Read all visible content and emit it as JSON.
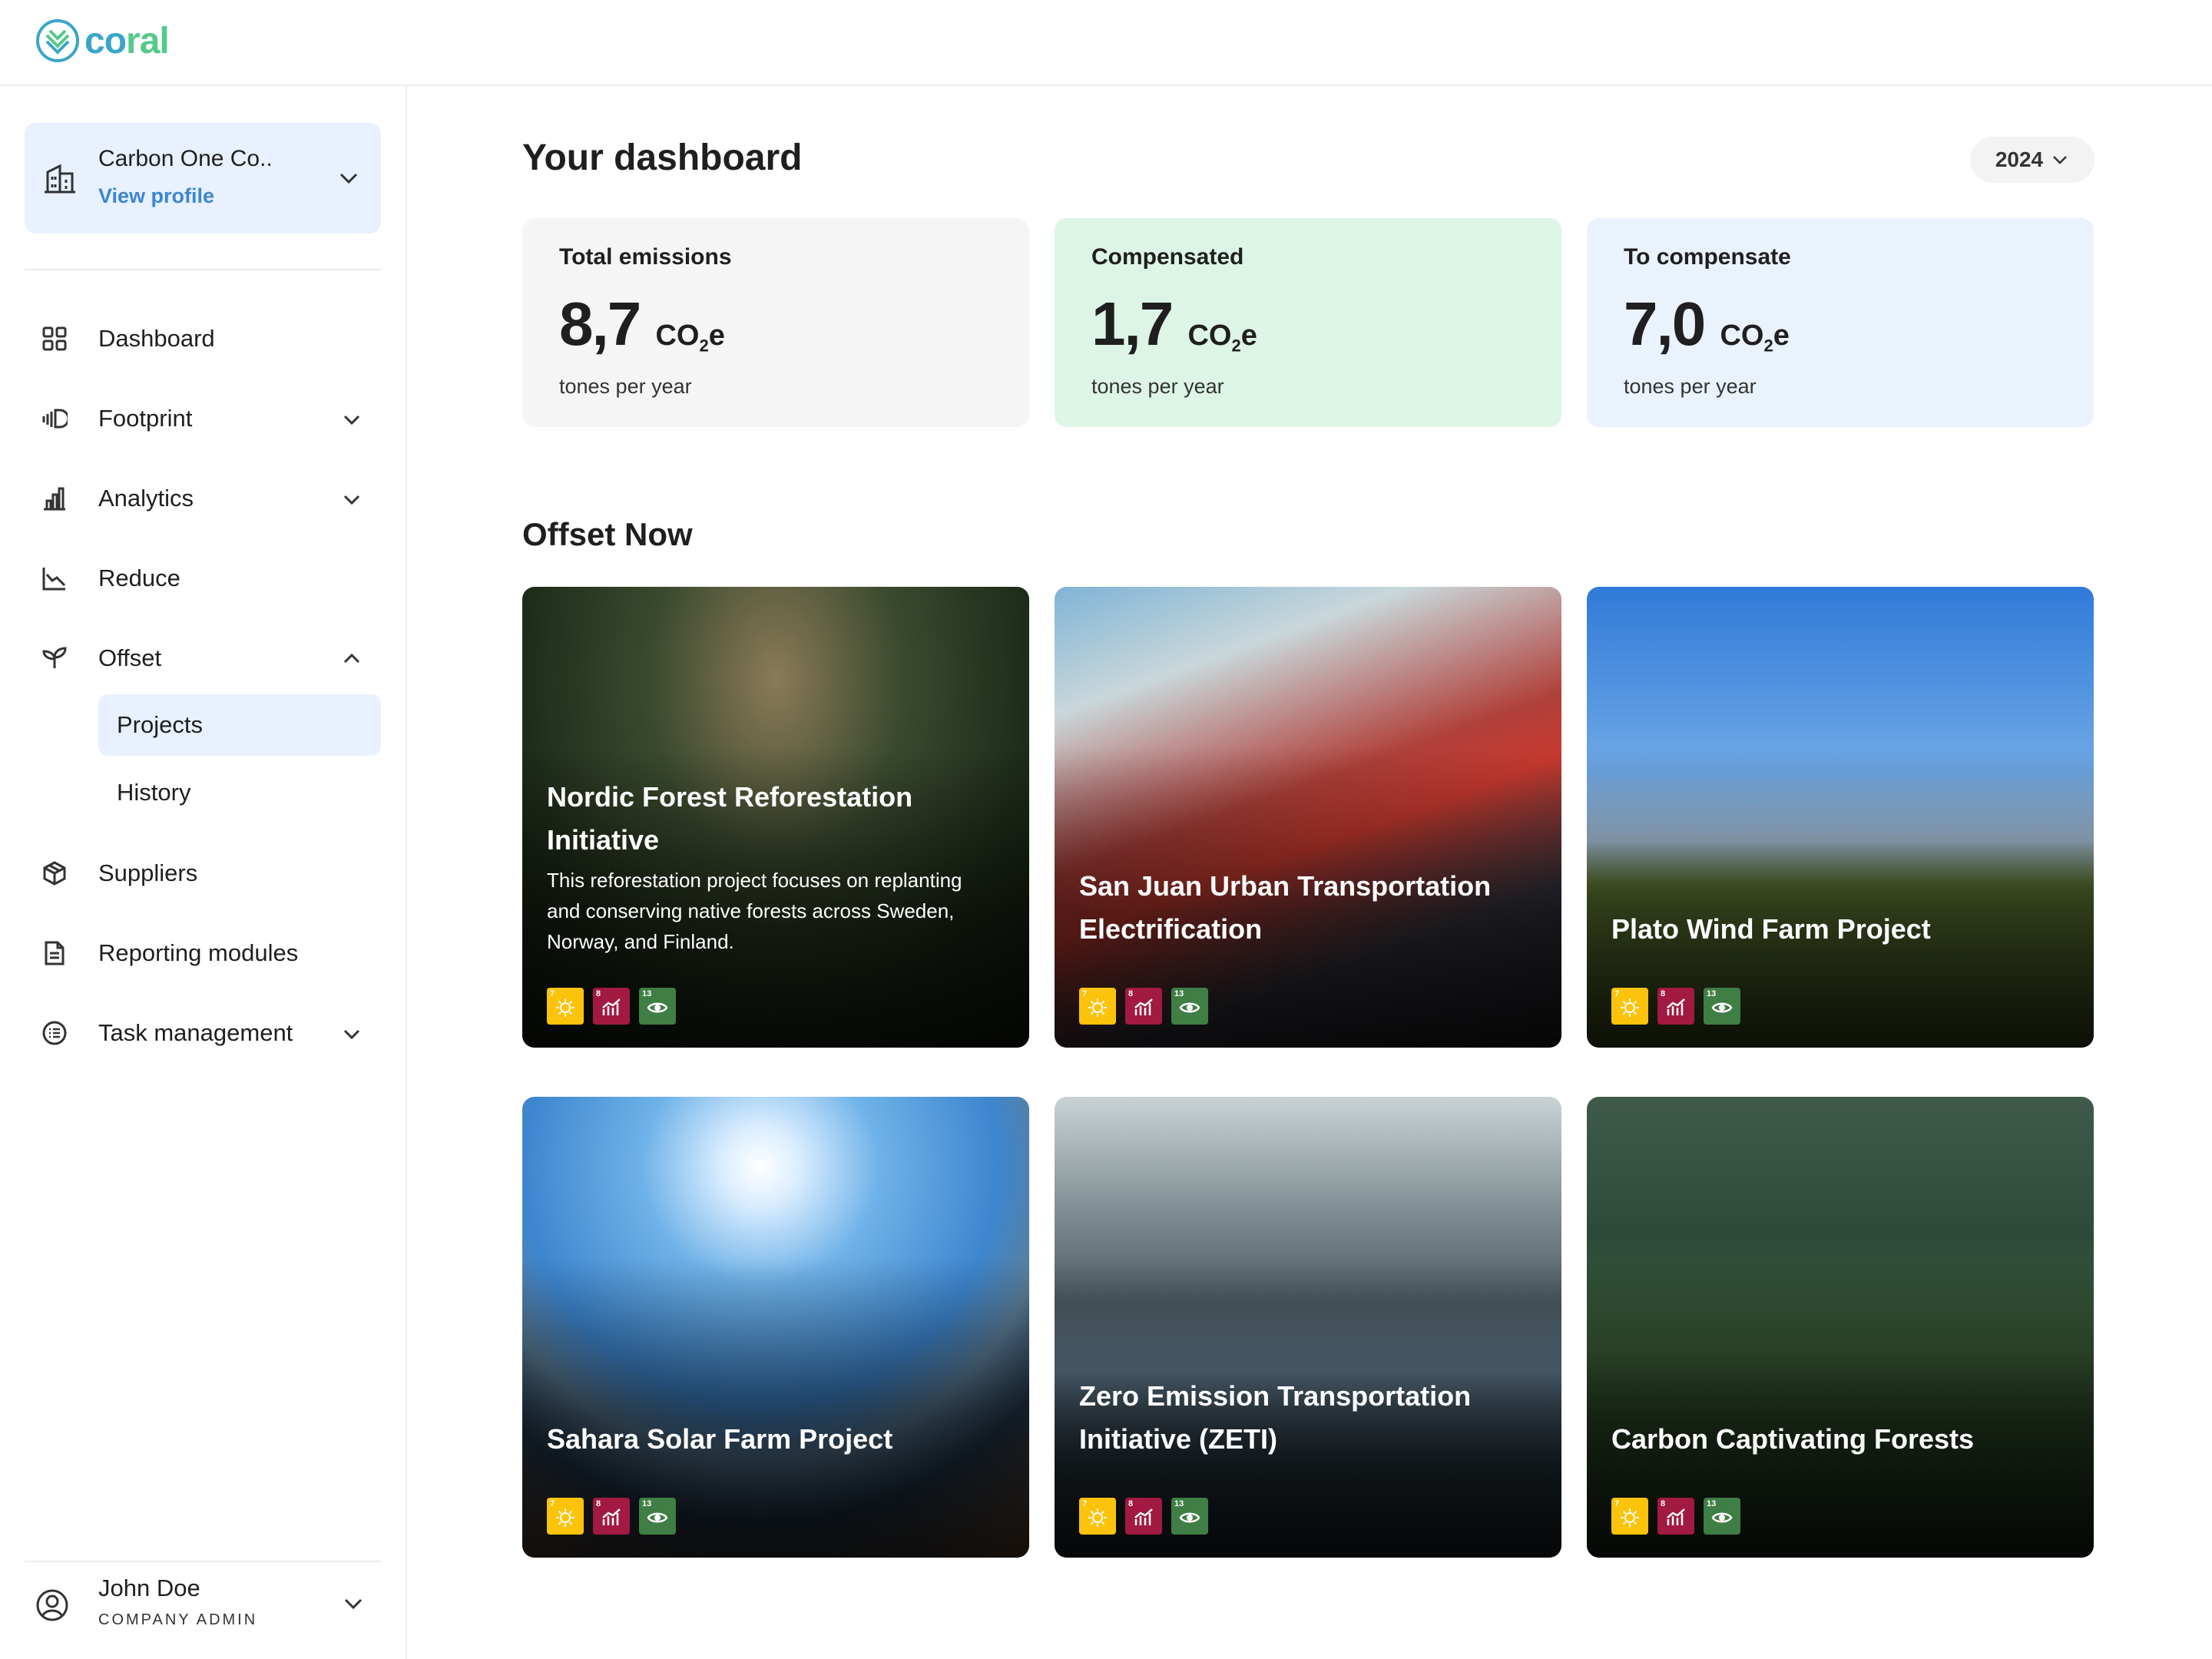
{
  "brand": {
    "name_part1": "co",
    "name_part2": "ral"
  },
  "org": {
    "name": "Carbon One Co..",
    "link": "View profile"
  },
  "nav": {
    "dashboard": "Dashboard",
    "footprint": "Footprint",
    "analytics": "Analytics",
    "reduce": "Reduce",
    "offset": "Offset",
    "projects": "Projects",
    "history": "History",
    "suppliers": "Suppliers",
    "reporting": "Reporting modules",
    "tasks": "Task management"
  },
  "user": {
    "name": "John Doe",
    "role": "COMPANY ADMIN"
  },
  "header": {
    "title": "Your dashboard",
    "year": "2024"
  },
  "stats": [
    {
      "label": "Total emissions",
      "value": "8,7",
      "unit": "CO",
      "unit_sub": "2",
      "unit_tail": "e",
      "caption": "tones per year",
      "bg": "#f5f5f5"
    },
    {
      "label": "Compensated",
      "value": "1,7",
      "unit": "CO",
      "unit_sub": "2",
      "unit_tail": "e",
      "caption": "tones per year",
      "bg": "#dcf5e6"
    },
    {
      "label": "To compensate",
      "value": "7,0",
      "unit": "CO",
      "unit_sub": "2",
      "unit_tail": "e",
      "caption": "tones per year",
      "bg": "#eaf2fd"
    }
  ],
  "offset": {
    "title": "Offset Now",
    "projects": [
      {
        "title": "Nordic Forest Reforestation Initiative",
        "desc": "This reforestation project focuses on replanting and conserving native forests across Sweden, Norway, and Finland."
      },
      {
        "title": "San Juan Urban Transportation Electrification",
        "desc": ""
      },
      {
        "title": "Plato Wind Farm Project",
        "desc": ""
      },
      {
        "title": "Sahara Solar Farm Project",
        "desc": ""
      },
      {
        "title": "Zero Emission Transportation Initiative (ZETI)",
        "desc": ""
      },
      {
        "title": "Carbon Captivating Forests",
        "desc": ""
      }
    ],
    "sdg_badges": [
      {
        "num": "7",
        "color": "#fcc30b",
        "icon": "sun-icon"
      },
      {
        "num": "8",
        "color": "#a21942",
        "icon": "growth-chart-icon"
      },
      {
        "num": "13",
        "color": "#3f7e44",
        "icon": "eye-icon"
      }
    ]
  },
  "colors": {
    "accent": "#3b86d6",
    "active_bg": "#e8f1fd",
    "logo_blue": "#3aa5c9",
    "logo_green": "#55c98a"
  }
}
